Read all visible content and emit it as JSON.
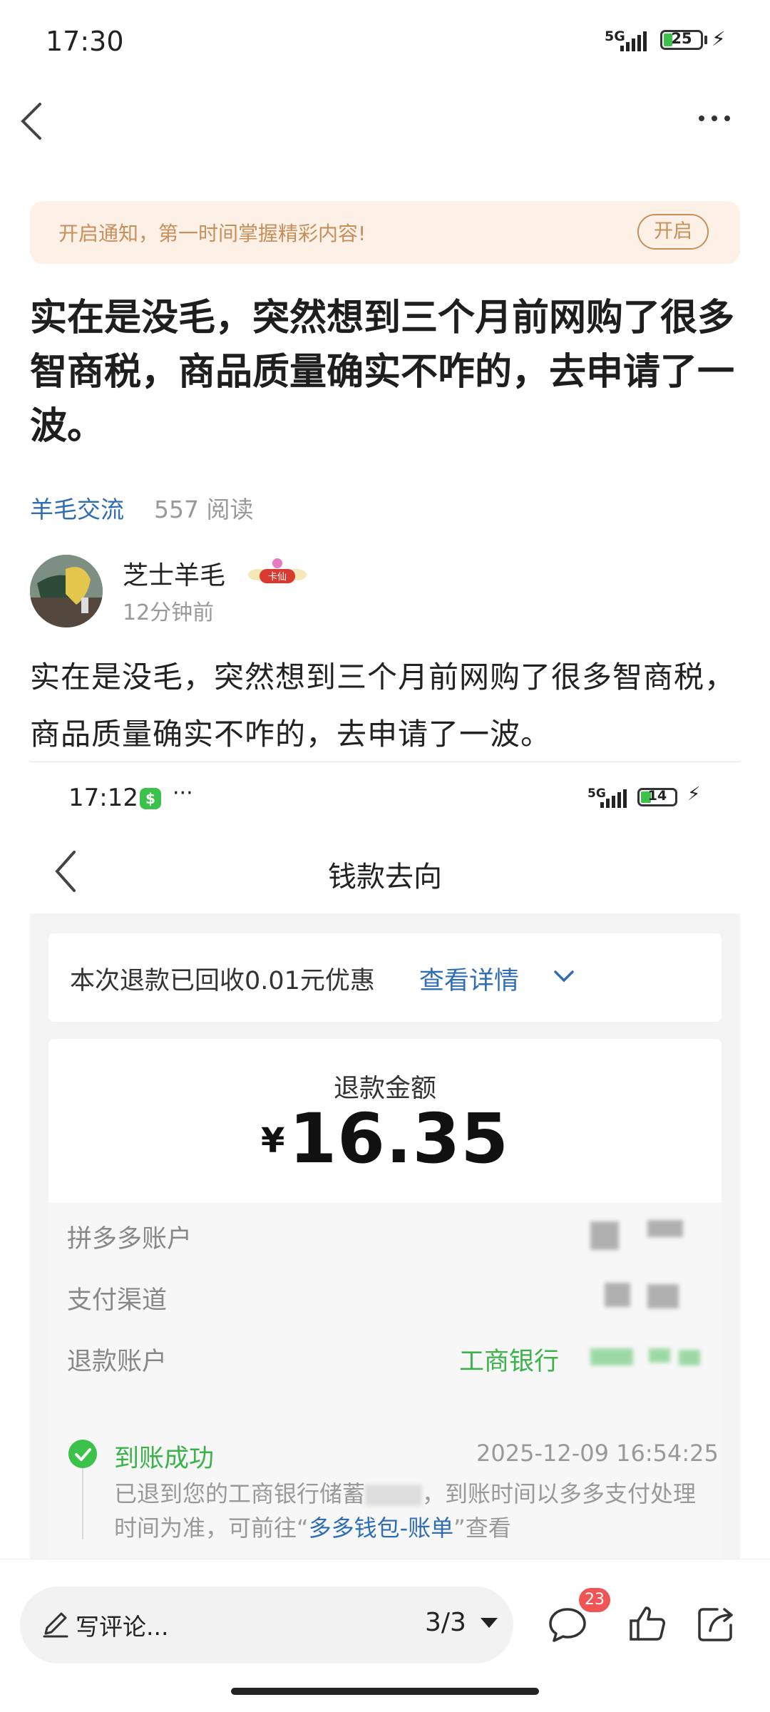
{
  "status_bar": {
    "time": "17:30",
    "network": "5G",
    "battery": "25"
  },
  "banner": {
    "text": "开启通知，第一时间掌握精彩内容!",
    "button": "开启"
  },
  "post": {
    "title": "实在是没毛，突然想到三个月前网购了很多智商税，商品质量确实不咋的，去申请了一波。",
    "category": "羊毛交流",
    "reads": "557 阅读",
    "author": "芝士羊毛",
    "badge": "卡仙",
    "time_ago": "12分钟前",
    "body": "实在是没毛，突然想到三个月前网购了很多智商税，商品质量确实不咋的，去申请了一波。"
  },
  "embedded": {
    "status_time": "17:12",
    "status_dots": "···",
    "network": "5G",
    "battery": "14",
    "nav_title": "钱款去向",
    "recovered_text": "本次退款已回收0.01元优惠",
    "view_detail": "查看详情",
    "refund_label": "退款金额",
    "currency": "¥",
    "refund_amount": "16.35",
    "rows": [
      {
        "label": "拼多多账户"
      },
      {
        "label": "支付渠道"
      },
      {
        "label": "退款账户",
        "value": "工商银行"
      }
    ],
    "status": "到账成功",
    "status_time_full": "2025-12-09 16:54:25",
    "desc_part1": "已退到您的工商银行储蓄",
    "desc_part2": "，到账时间以多多支付处理时间为准，可前往“",
    "desc_link": "多多钱包-账单",
    "desc_part3": "”查看"
  },
  "bottom_bar": {
    "placeholder": "写评论...",
    "pager": "3/3",
    "comment_count": "23"
  }
}
